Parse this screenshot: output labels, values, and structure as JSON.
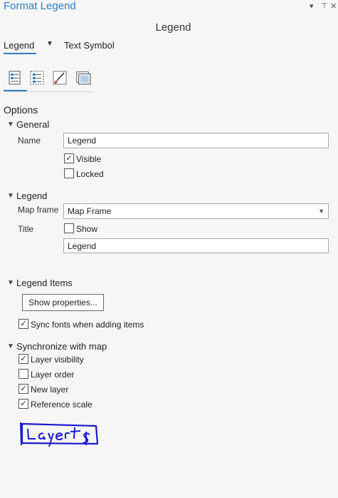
{
  "window": {
    "title": "Format Legend",
    "pin_glyph": "⊥",
    "close_glyph": "✕",
    "menu_glyph": "▾"
  },
  "pane": {
    "heading": "Legend"
  },
  "tabs": [
    {
      "label": "Legend",
      "active": true
    },
    {
      "label": "Text Symbol",
      "active": false
    }
  ],
  "icon_tabs": [
    {
      "name": "options-icon",
      "active": true
    },
    {
      "name": "legend-arrangement-icon",
      "active": false
    },
    {
      "name": "symbol-brush-icon",
      "active": false
    },
    {
      "name": "display-frame-icon",
      "active": false
    }
  ],
  "options": {
    "heading": "Options",
    "general": {
      "heading": "General",
      "name_label": "Name",
      "name_value": "Legend",
      "visible_label": "Visible",
      "visible_checked": true,
      "locked_label": "Locked",
      "locked_checked": false
    },
    "legend": {
      "heading": "Legend",
      "map_frame_label": "Map frame",
      "map_frame_value": "Map Frame",
      "title_label": "Title",
      "show_label": "Show",
      "show_checked": false,
      "title_value": "Legend"
    },
    "legend_items": {
      "heading": "Legend Items",
      "show_properties_label": "Show properties...",
      "sync_fonts_label": "Sync fonts when adding items",
      "sync_fonts_checked": true
    },
    "synchronize": {
      "heading": "Synchronize with map",
      "items": [
        {
          "label": "Layer visibility",
          "checked": true
        },
        {
          "label": "Layer order",
          "checked": false
        },
        {
          "label": "New layer",
          "checked": true
        },
        {
          "label": "Reference scale",
          "checked": true
        }
      ]
    }
  },
  "annotation": {
    "text": "Layers",
    "color": "#1a1acc"
  }
}
